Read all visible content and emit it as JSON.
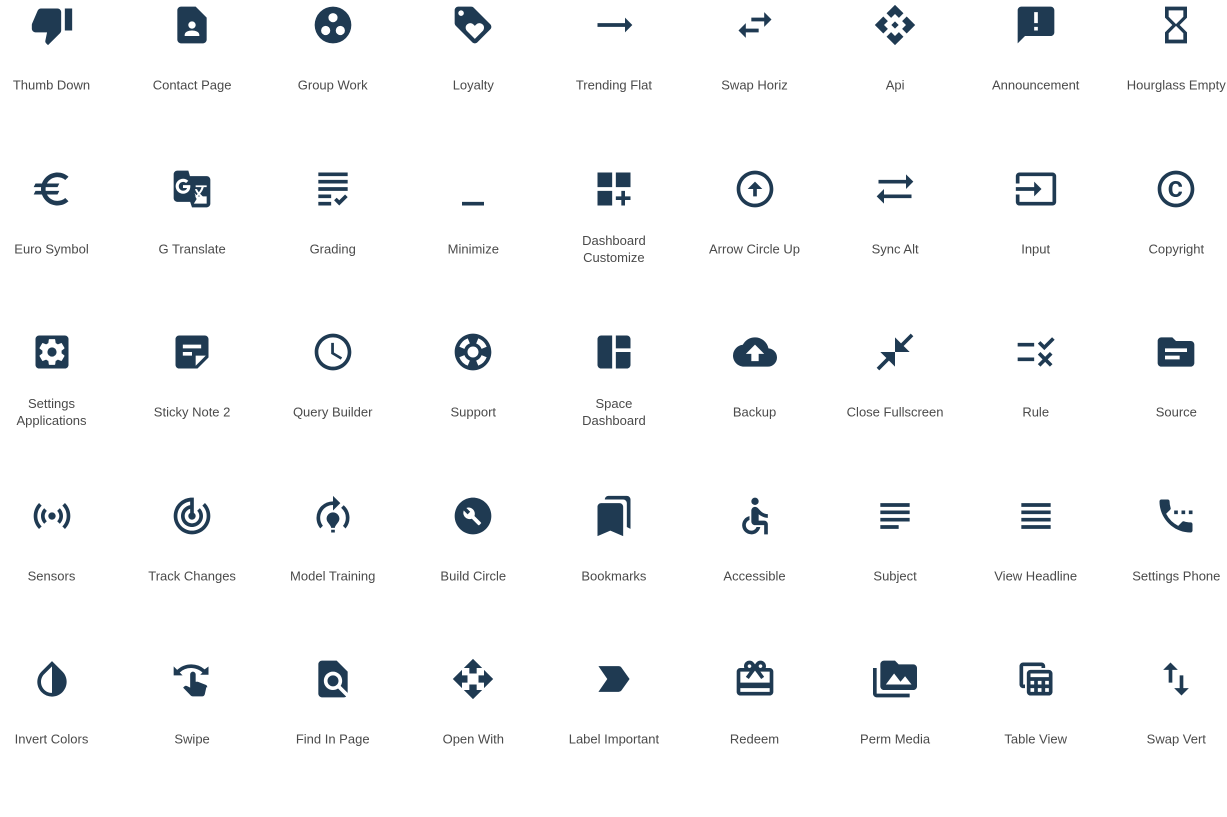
{
  "colors": {
    "icon": "#1f3a52",
    "label": "#4a4a4a",
    "background": "#ffffff"
  },
  "icons": [
    {
      "id": "thumb-down",
      "label": "Thumb Down"
    },
    {
      "id": "contact-page",
      "label": "Contact Page"
    },
    {
      "id": "group-work",
      "label": "Group Work"
    },
    {
      "id": "loyalty",
      "label": "Loyalty"
    },
    {
      "id": "trending-flat",
      "label": "Trending Flat"
    },
    {
      "id": "swap-horiz",
      "label": "Swap Horiz"
    },
    {
      "id": "api",
      "label": "Api"
    },
    {
      "id": "announcement",
      "label": "Announcement"
    },
    {
      "id": "hourglass-empty",
      "label": "Hourglass Empty"
    },
    {
      "id": "euro-symbol",
      "label": "Euro Symbol"
    },
    {
      "id": "g-translate",
      "label": "G Translate"
    },
    {
      "id": "grading",
      "label": "Grading"
    },
    {
      "id": "minimize",
      "label": "Minimize"
    },
    {
      "id": "dashboard-customize",
      "label": "Dashboard\nCustomize"
    },
    {
      "id": "arrow-circle-up",
      "label": "Arrow Circle Up"
    },
    {
      "id": "sync-alt",
      "label": "Sync Alt"
    },
    {
      "id": "input",
      "label": "Input"
    },
    {
      "id": "copyright",
      "label": "Copyright"
    },
    {
      "id": "settings-applications",
      "label": "Settings\nApplications"
    },
    {
      "id": "sticky-note-2",
      "label": "Sticky Note 2"
    },
    {
      "id": "query-builder",
      "label": "Query Builder"
    },
    {
      "id": "support",
      "label": "Support"
    },
    {
      "id": "space-dashboard",
      "label": "Space\nDashboard"
    },
    {
      "id": "backup",
      "label": "Backup"
    },
    {
      "id": "close-fullscreen",
      "label": "Close Fullscreen"
    },
    {
      "id": "rule",
      "label": "Rule"
    },
    {
      "id": "source",
      "label": "Source"
    },
    {
      "id": "sensors",
      "label": "Sensors"
    },
    {
      "id": "track-changes",
      "label": "Track Changes"
    },
    {
      "id": "model-training",
      "label": "Model Training"
    },
    {
      "id": "build-circle",
      "label": "Build Circle"
    },
    {
      "id": "bookmarks",
      "label": "Bookmarks"
    },
    {
      "id": "accessible",
      "label": "Accessible"
    },
    {
      "id": "subject",
      "label": "Subject"
    },
    {
      "id": "view-headline",
      "label": "View Headline"
    },
    {
      "id": "settings-phone",
      "label": "Settings Phone"
    },
    {
      "id": "invert-colors",
      "label": "Invert Colors"
    },
    {
      "id": "swipe",
      "label": "Swipe"
    },
    {
      "id": "find-in-page",
      "label": "Find In Page"
    },
    {
      "id": "open-with",
      "label": "Open With"
    },
    {
      "id": "label-important",
      "label": "Label Important"
    },
    {
      "id": "redeem",
      "label": "Redeem"
    },
    {
      "id": "perm-media",
      "label": "Perm Media"
    },
    {
      "id": "table-view",
      "label": "Table View"
    },
    {
      "id": "swap-vert",
      "label": "Swap Vert"
    }
  ]
}
